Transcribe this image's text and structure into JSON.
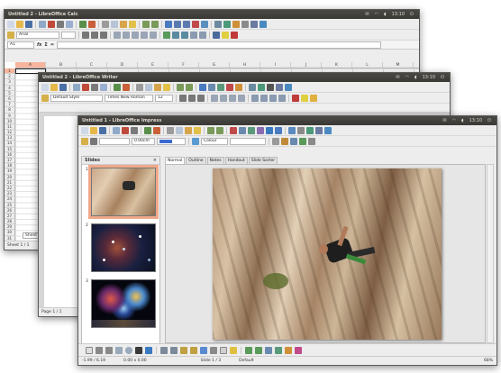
{
  "calc": {
    "title": "Untitled 2 - LibreOffice Calc",
    "time": "13:10",
    "font_name": "Arial",
    "cell_ref": "A1",
    "fx": "fx",
    "sum": "Σ",
    "eq": "=",
    "columns": [
      "A",
      "B",
      "C",
      "D",
      "E",
      "F",
      "G",
      "H",
      "I",
      "J",
      "K",
      "L",
      "M",
      "N",
      "O"
    ],
    "rows": [
      "1",
      "2",
      "3",
      "4",
      "5",
      "6",
      "7",
      "8",
      "9",
      "10",
      "11",
      "12",
      "13",
      "14",
      "15",
      "16",
      "17",
      "18",
      "19",
      "20",
      "21",
      "22",
      "23",
      "24",
      "25",
      "26",
      "27",
      "28",
      "29",
      "30",
      "31",
      "32"
    ],
    "sheet_tab": "Sheet1",
    "status": "Sheet 1 / 1"
  },
  "writer": {
    "title": "Untitled 2 - LibreOffice Writer",
    "time": "13:10",
    "para_style": "Default Style",
    "font_name": "Times New Roman",
    "font_size": "12",
    "status": "Page 1 / 1"
  },
  "impress": {
    "title": "Untitled 1 - LibreOffice Impress",
    "time": "13:10",
    "line_width": "0.00cm",
    "fill_label": "Colour",
    "pane_title": "Slides",
    "pane_close": "×",
    "tabs": [
      "Normal",
      "Outline",
      "Notes",
      "Handout",
      "Slide Sorter"
    ],
    "thumb_numbers": [
      "1",
      "2",
      "3"
    ],
    "status_pos": "-1.99 / 6.19",
    "status_size": "0.00 x 0.00",
    "status_slide": "Slide 1 / 3",
    "status_layout": "Default",
    "status_zoom": "68%"
  },
  "colors": {
    "titlebar": "#3c3b37",
    "selection": "#f7b59d",
    "chrome": "#ededed"
  }
}
